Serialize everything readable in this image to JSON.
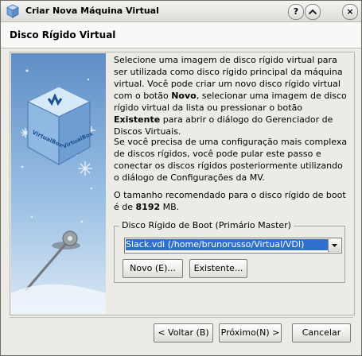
{
  "window": {
    "title": "Criar Nova Máquina Virtual",
    "help_label": "?",
    "minimize_icon": "chevron-up-icon",
    "close_label": "×"
  },
  "header": {
    "title": "Disco Rígido Virtual"
  },
  "description": {
    "p1_part1": "Selecione uma imagem de disco rígido virtual para ser utilizada como disco rígido principal da máquina virtual. Você pode criar um novo disco rígido virtual com o botão ",
    "p1_bold1": "Novo",
    "p1_part2": ", selecionar uma imagem de disco rígido virtual da lista ou pressionar o botão ",
    "p1_bold2": "Existente",
    "p1_part3": " para abrir o diálogo do Gerenciador de Discos Virtuais.",
    "p2": "Se você precisa de uma configuração mais complexa de discos rígidos, você pode pular este passo e conectar os discos rígidos posteriormente utilizando o diálogo de Configurações da MV.",
    "p3_part1": "O tamanho recomendado para o disco rígido de boot é de ",
    "p3_bold": "8192",
    "p3_part2": " MB."
  },
  "boot_disk": {
    "group_title": "Disco Rígido de Boot (Primário Master)",
    "selected_value": "Slack.vdi (/home/brunorusso/Virtual/VDI)",
    "new_button_label": "Novo (E)...",
    "existing_button_label": "Existente..."
  },
  "footer": {
    "back_label": "< Voltar (B)",
    "next_label": "Próximo(N) >",
    "cancel_label": "Cancelar"
  }
}
